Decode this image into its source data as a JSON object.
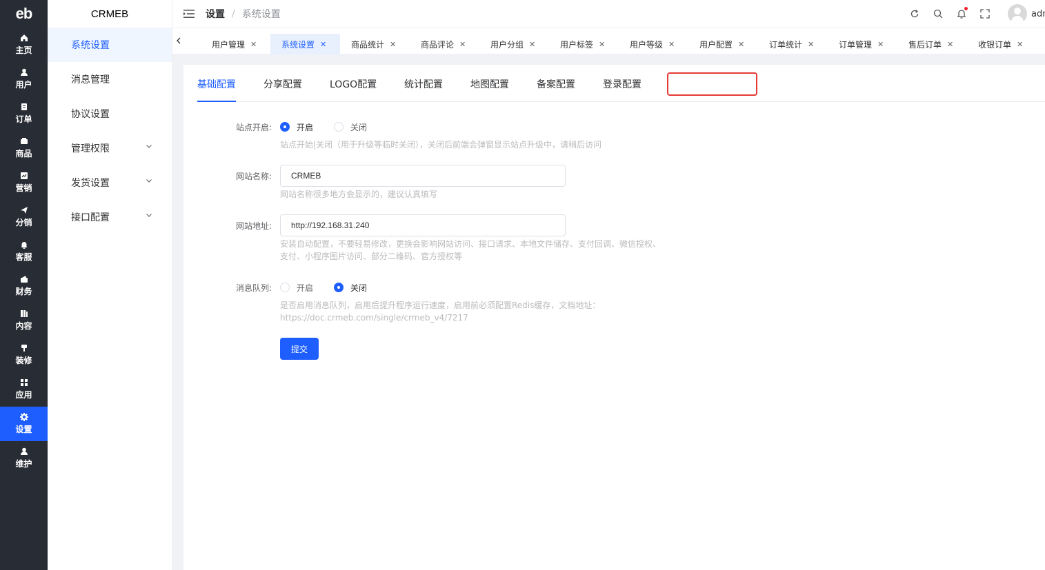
{
  "app": {
    "logo_text": "eb",
    "title": "CRMEB"
  },
  "rail": [
    {
      "label": "主页",
      "icon": "home-icon"
    },
    {
      "label": "用户",
      "icon": "user-icon"
    },
    {
      "label": "订单",
      "icon": "order-icon"
    },
    {
      "label": "商品",
      "icon": "goods-icon"
    },
    {
      "label": "营销",
      "icon": "marketing-icon"
    },
    {
      "label": "分销",
      "icon": "share-icon"
    },
    {
      "label": "客服",
      "icon": "bell-icon"
    },
    {
      "label": "财务",
      "icon": "wallet-icon"
    },
    {
      "label": "内容",
      "icon": "content-icon"
    },
    {
      "label": "装修",
      "icon": "brush-icon"
    },
    {
      "label": "应用",
      "icon": "grid-icon"
    },
    {
      "label": "设置",
      "icon": "gear-icon",
      "active": true
    },
    {
      "label": "维护",
      "icon": "maintain-icon"
    }
  ],
  "submenu": [
    {
      "label": "系统设置",
      "active": true,
      "expandable": false
    },
    {
      "label": "消息管理",
      "expandable": false
    },
    {
      "label": "协议设置",
      "expandable": false
    },
    {
      "label": "管理权限",
      "expandable": true
    },
    {
      "label": "发货设置",
      "expandable": true
    },
    {
      "label": "接口配置",
      "expandable": true
    }
  ],
  "header": {
    "breadcrumb_root": "设置",
    "breadcrumb_sep": "/",
    "breadcrumb_current": "系统设置",
    "username": "admin"
  },
  "tabs": [
    {
      "label": "用户管理"
    },
    {
      "label": "系统设置",
      "active": true
    },
    {
      "label": "商品统计"
    },
    {
      "label": "商品评论"
    },
    {
      "label": "用户分组"
    },
    {
      "label": "用户标签"
    },
    {
      "label": "用户等级"
    },
    {
      "label": "用户配置"
    },
    {
      "label": "订单统计"
    },
    {
      "label": "订单管理"
    },
    {
      "label": "售后订单"
    },
    {
      "label": "收银订单"
    }
  ],
  "config_tabs": [
    {
      "label": "基础配置",
      "active": true
    },
    {
      "label": "分享配置"
    },
    {
      "label": "LOGO配置"
    },
    {
      "label": "统计配置"
    },
    {
      "label": "地图配置"
    },
    {
      "label": "备案配置"
    },
    {
      "label": "登录配置"
    }
  ],
  "form": {
    "site_open": {
      "label": "站点开启:",
      "opt_on": "开启",
      "opt_off": "关闭",
      "selected": "开启",
      "tip": "站点开始|关闭（用于升级等临时关闭），关闭后前端会弹窗显示站点升级中，请稍后访问"
    },
    "site_name": {
      "label": "网站名称:",
      "value": "CRMEB",
      "tip": "网站名称很多地方会显示的，建议认真填写"
    },
    "site_url": {
      "label": "网站地址:",
      "value": "http://192.168.31.240",
      "tip1": "安装自动配置，不要轻易修改，更换会影响网站访问、接口请求、本地文件储存、支付回调、微信授权、",
      "tip2": "支付、小程序图片访问、部分二维码、官方授权等"
    },
    "queue": {
      "label": "消息队列:",
      "opt_on": "开启",
      "opt_off": "关闭",
      "selected": "关闭",
      "tip1": "是否启用消息队列，启用后提升程序运行速度，启用前必须配置Redis缓存，文档地址：",
      "tip2": "https://doc.crmeb.com/single/crmeb_v4/7217"
    },
    "submit_label": "提交"
  },
  "colors": {
    "primary": "#1e5eff",
    "rail_bg": "#282c34",
    "highlight_box": "#e53935"
  }
}
